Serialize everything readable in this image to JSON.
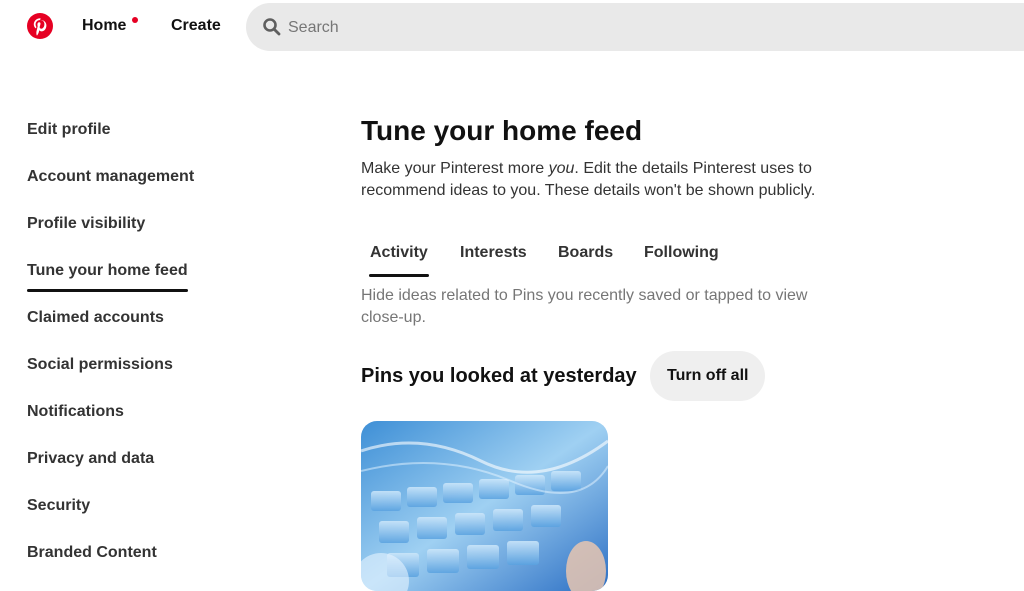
{
  "topbar": {
    "logo_icon": "pinterest-logo-icon",
    "home_label": "Home",
    "create_label": "Create",
    "search_placeholder": "Search",
    "search_icon": "search-icon",
    "brand_color": "#e60023"
  },
  "sidebar": {
    "items": [
      {
        "label": "Edit profile",
        "active": false
      },
      {
        "label": "Account management",
        "active": false
      },
      {
        "label": "Profile visibility",
        "active": false
      },
      {
        "label": "Tune your home feed",
        "active": true
      },
      {
        "label": "Claimed accounts",
        "active": false
      },
      {
        "label": "Social permissions",
        "active": false
      },
      {
        "label": "Notifications",
        "active": false
      },
      {
        "label": "Privacy and data",
        "active": false
      },
      {
        "label": "Security",
        "active": false
      },
      {
        "label": "Branded Content",
        "active": false
      }
    ]
  },
  "main": {
    "title": "Tune your home feed",
    "description_before": "Make your Pinterest more ",
    "description_emph": "you",
    "description_after": ". Edit the details Pinterest uses to recommend ideas to you. These details won't be shown publicly.",
    "tabs": [
      {
        "label": "Activity",
        "active": true
      },
      {
        "label": "Interests",
        "active": false
      },
      {
        "label": "Boards",
        "active": false
      },
      {
        "label": "Following",
        "active": false
      }
    ],
    "tab_description": "Hide ideas related to Pins you recently saved or tapped to view close-up.",
    "section_title": "Pins you looked at yesterday",
    "turn_off_label": "Turn off all"
  }
}
